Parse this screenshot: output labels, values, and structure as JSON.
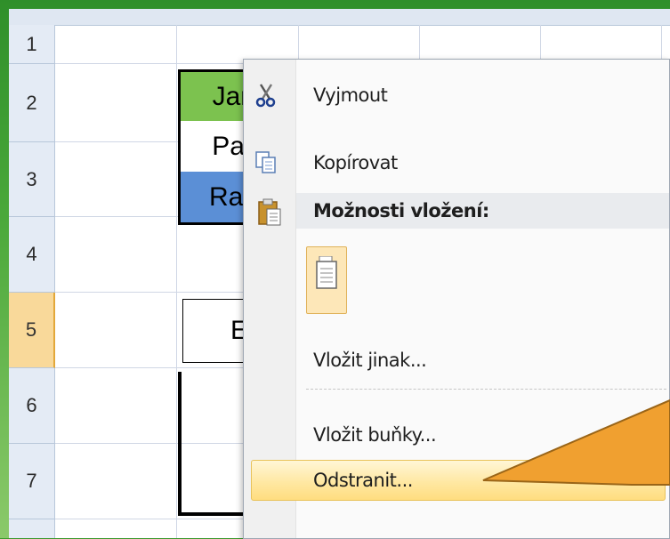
{
  "row_headers": [
    "1",
    "2",
    "3",
    "4",
    "5",
    "6",
    "7"
  ],
  "selected_row": "5",
  "cells": [
    {
      "row": "2",
      "text": "Jan",
      "fill": "#7cc24f"
    },
    {
      "row": "3",
      "text": "Pav",
      "fill": "#ffffff"
    },
    {
      "row": "4",
      "text": "Rad",
      "fill": "#5b8fd6"
    },
    {
      "row": "5",
      "text": "Ev",
      "fill": "#ffffff"
    }
  ],
  "context_menu": {
    "cut_label": "Vyjmout",
    "copy_label": "Kopírovat",
    "paste_options_label": "Možnosti vložení:",
    "paste_special_label": "Vložit jinak...",
    "insert_cells_label": "Vložit buňky...",
    "delete_label": "Odstranit..."
  },
  "colors": {
    "frame_green": "#3c9a2e",
    "highlight": "#ffe8a3",
    "callout_arrow": "#f0a030"
  }
}
